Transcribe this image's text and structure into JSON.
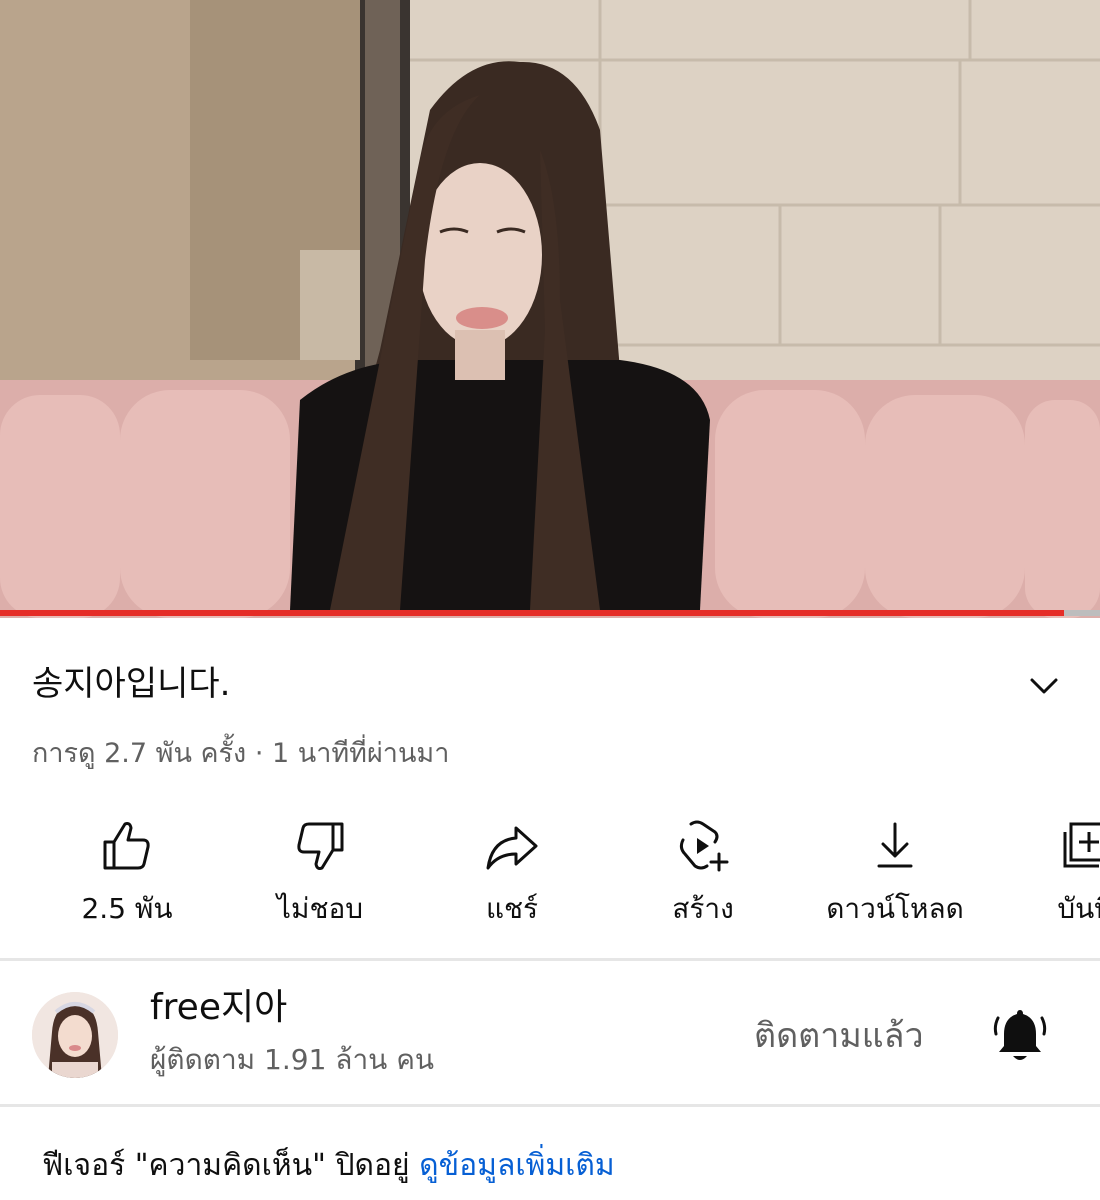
{
  "video": {
    "progress_fraction": 0.967,
    "colors": {
      "progress": "#e52d27",
      "track": "#bdbdbd"
    }
  },
  "title": {
    "text": "송지아입니다.",
    "expand_icon": "chevron-down-icon"
  },
  "meta": {
    "views": "การดู 2.7 พัน ครั้ง",
    "separator": " · ",
    "time": "1 นาทีที่ผ่านมา"
  },
  "actions": [
    {
      "id": "like",
      "icon": "thumbs-up-icon",
      "label": "2.5 พัน"
    },
    {
      "id": "dislike",
      "icon": "thumbs-down-icon",
      "label": "ไม่ชอบ"
    },
    {
      "id": "share",
      "icon": "share-arrow-icon",
      "label": "แชร์"
    },
    {
      "id": "create",
      "icon": "create-clip-icon",
      "label": "สร้าง"
    },
    {
      "id": "download",
      "icon": "download-icon",
      "label": "ดาวน์โหลด"
    },
    {
      "id": "save",
      "icon": "add-to-playlist-icon",
      "label": "บันทึ"
    }
  ],
  "channel": {
    "name": "free지아",
    "subscribers": "ผู้ติดตาม 1.91 ล้าน คน",
    "subscribe_state": "ติดตามแล้ว",
    "bell_icon": "bell-icon"
  },
  "comments_notice": {
    "text": "ฟีเจอร์ \"ความคิดเห็น\" ปิดอยู่ ",
    "link": "ดูข้อมูลเพิ่มเติม",
    "link_color": "#065fd4"
  }
}
